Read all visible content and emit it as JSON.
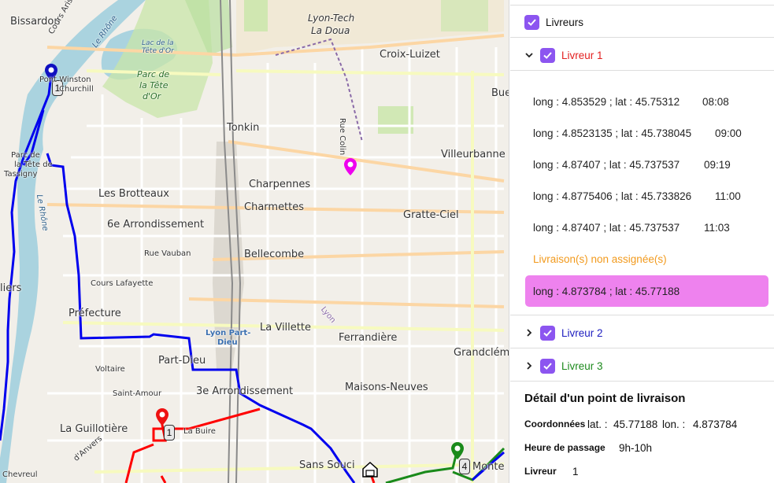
{
  "map": {
    "labels": {
      "bissardon": "Bissardon",
      "lyon_tech": "Lyon-Tech",
      "la_doua": "La Doua",
      "croix_luizet": "Croix-Luizet",
      "parc_tete_dor_1": "Parc de",
      "parc_tete_dor_2": "la Tête",
      "parc_tete_dor_3": "d'Or",
      "lac": "Lac de la Tête d'Or",
      "cours_aristide": "Cours Aristide Briand",
      "le_rhone_1": "Le Rhône",
      "le_rhone_2": "Le Rhône",
      "pont_winston": "Pont Winston",
      "churchill": "Churchill",
      "parc_de": "Parc de",
      "la_tete_de": "la Tête de",
      "tassigny": "Tassigny",
      "tonkin": "Tonkin",
      "rue_colin": "Rue Colin",
      "villeurbanne": "Villeurbanne",
      "bue": "Bue",
      "charpennes": "Charpennes",
      "charmettes": "Charmettes",
      "gratte_ciel": "Gratte-Ciel",
      "les_brotteaux": "Les Brotteaux",
      "sixieme": "6e Arrondissement",
      "rue_vauban": "Rue Vauban",
      "bellecombe": "Bellecombe",
      "cours_lafayette": "Cours Lafayette",
      "liers": "liers",
      "prefecture": "Préfecture",
      "lyon_part_dieu_1": "Lyon Part-",
      "lyon_part_dieu_2": "Dieu",
      "la_villette": "La Villette",
      "lyon_rail": "Lyon",
      "ferrandiere": "Ferrandière",
      "grandclement": "Grandclém",
      "voltaire": "Voltaire",
      "part_dieu": "Part-Dieu",
      "troisieme": "3e Arrondissement",
      "maisons_neuves": "Maisons-Neuves",
      "saint_amour": "Saint-Amour",
      "la_buire": "La Buire",
      "la_guillotiere": "La Guillotière",
      "anvers": "d'Anvers",
      "sans_souci": "Sans Souci",
      "monte": "Monte",
      "chevreul": "Chevreul"
    },
    "badges": {
      "blue_badge": "1",
      "red_badge": "1",
      "green_badge": "4"
    },
    "route_colors": {
      "livreur1": "#ff0000",
      "livreur2": "#0000ee",
      "livreur3": "#1a8a1a",
      "selected_marker": "#ee00ee"
    }
  },
  "panel": {
    "livreurs_label": "Livreurs",
    "livreur1": {
      "label": "Livreur 1",
      "color": "#e32020",
      "stops": [
        {
          "coords": "long : 4.853529 ; lat : 45.75312",
          "time": "08:08"
        },
        {
          "coords": "long : 4.8523135 ; lat : 45.738045",
          "time": "09:00"
        },
        {
          "coords": "long : 4.87407 ; lat : 45.737537",
          "time": "09:19"
        },
        {
          "coords": "long : 4.8775406 ; lat : 45.733826",
          "time": "11:00"
        },
        {
          "coords": "long : 4.87407 ; lat : 45.737537",
          "time": "11:03"
        }
      ],
      "unassigned_title": "Livraison(s) non assignée(s)",
      "unassigned_selected": "long : 4.873784 ; lat : 45.77188"
    },
    "livreur2": {
      "label": "Livreur 2",
      "color": "#1c1cbf"
    },
    "livreur3": {
      "label": "Livreur 3",
      "color": "#1d8a1d"
    },
    "checkbox_color": "#8c55f0",
    "detail": {
      "title": "Détail d'un point de livraison",
      "coords_label": "Coordonnées",
      "lat_label": "lat. :",
      "lat_value": "45.77188",
      "lon_label": "lon. :",
      "lon_value": "4.873784",
      "heure_label": "Heure de passage",
      "heure_value": "9h-10h",
      "livreur_label": "Livreur",
      "livreur_value": "1"
    }
  }
}
